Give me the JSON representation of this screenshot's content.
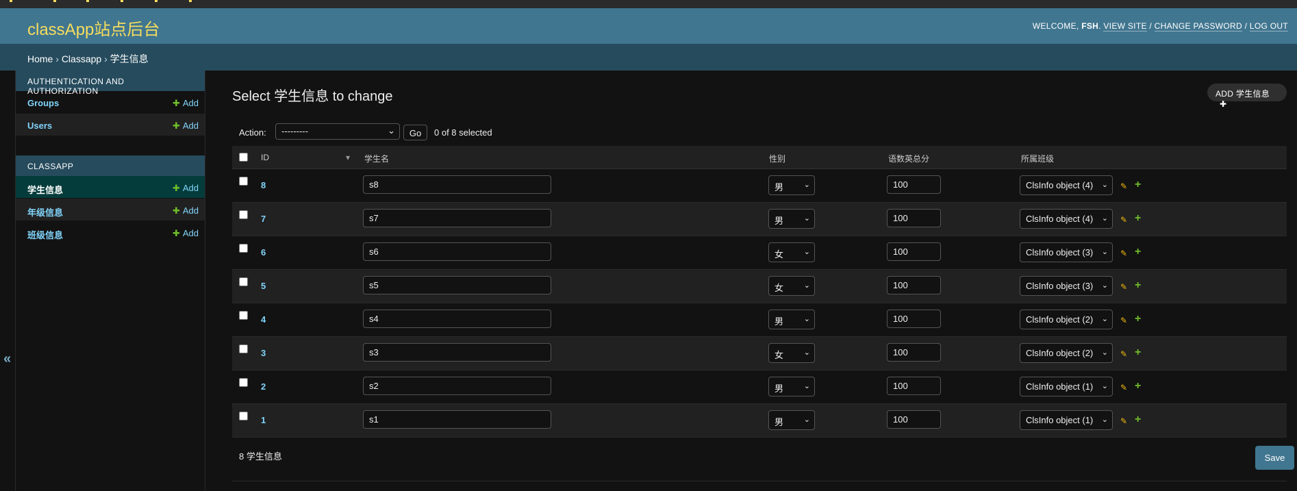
{
  "header": {
    "site_title": "classApp站点后台",
    "welcome": "WELCOME,",
    "username": "FSH",
    "view_site": "VIEW SITE",
    "change_password": "CHANGE PASSWORD",
    "log_out": "LOG OUT",
    "separator": "/",
    "period": "."
  },
  "breadcrumbs": {
    "home": "Home",
    "app": "Classapp",
    "current": "学生信息",
    "sep": "›"
  },
  "nav_toggle": "«",
  "sidebar": {
    "modules": [
      {
        "caption": "Authentication and Authorization",
        "items": [
          {
            "name": "Groups",
            "add": "Add"
          },
          {
            "name": "Users",
            "add": "Add"
          }
        ]
      },
      {
        "caption": "Classapp",
        "items": [
          {
            "name": "学生信息",
            "add": "Add"
          },
          {
            "name": "年级信息",
            "add": "Add"
          },
          {
            "name": "班级信息",
            "add": "Add"
          }
        ]
      }
    ]
  },
  "content": {
    "title": "Select 学生信息 to change",
    "add_button": "ADD 学生信息",
    "actions": {
      "label": "Action:",
      "selected_value": "---------",
      "go": "Go",
      "count": "0 of 8 selected"
    },
    "columns": [
      "ID",
      "学生名",
      "性别",
      "语数英总分",
      "所属班级"
    ],
    "rows": [
      {
        "id": "8",
        "name": "s8",
        "gender": "男",
        "score": "100",
        "cls": "ClsInfo object (4)"
      },
      {
        "id": "7",
        "name": "s7",
        "gender": "男",
        "score": "100",
        "cls": "ClsInfo object (4)"
      },
      {
        "id": "6",
        "name": "s6",
        "gender": "女",
        "score": "100",
        "cls": "ClsInfo object (3)"
      },
      {
        "id": "5",
        "name": "s5",
        "gender": "女",
        "score": "100",
        "cls": "ClsInfo object (3)"
      },
      {
        "id": "4",
        "name": "s4",
        "gender": "男",
        "score": "100",
        "cls": "ClsInfo object (2)"
      },
      {
        "id": "3",
        "name": "s3",
        "gender": "女",
        "score": "100",
        "cls": "ClsInfo object (2)"
      },
      {
        "id": "2",
        "name": "s2",
        "gender": "男",
        "score": "100",
        "cls": "ClsInfo object (1)"
      },
      {
        "id": "1",
        "name": "s1",
        "gender": "男",
        "score": "100",
        "cls": "ClsInfo object (1)"
      }
    ],
    "total": "8 学生信息",
    "save": "Save"
  },
  "colors": {
    "header_bg": "#417690",
    "breadcrumb_bg": "#264b5d",
    "title_yellow": "#f5dd5d",
    "link_blue": "#81d4fa",
    "add_green": "#70bf2b",
    "current_row": "#043c3b"
  },
  "icons": [
    "chevron-double-left-icon",
    "plus-icon",
    "pencil-icon",
    "sort-arrow-icon",
    "dropdown-chevron-icon"
  ]
}
